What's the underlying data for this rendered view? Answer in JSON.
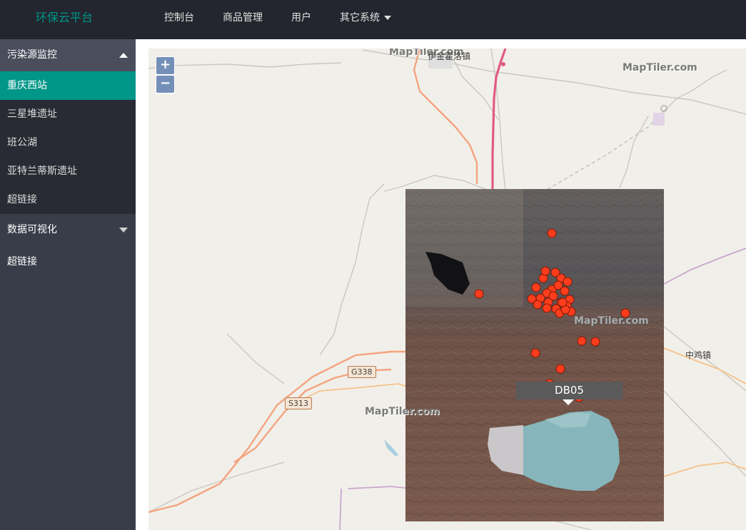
{
  "header": {
    "brand": "环保云平台",
    "nav": [
      {
        "label": "控制台"
      },
      {
        "label": "商品管理"
      },
      {
        "label": "用户"
      },
      {
        "label": "其它系统"
      }
    ]
  },
  "sidebar": {
    "group1": {
      "label": "污染源监控",
      "items": [
        {
          "label": "重庆西站"
        },
        {
          "label": "三星堆遗址"
        },
        {
          "label": "班公湖"
        },
        {
          "label": "亚特兰蒂斯遗址"
        },
        {
          "label": "超链接"
        }
      ]
    },
    "group2": {
      "label": "数据可视化"
    },
    "link": {
      "label": "超链接"
    }
  },
  "map": {
    "zoom_in": "+",
    "zoom_out": "−",
    "places": {
      "town1": "伊金霍洛镇",
      "town2": "中鸡镇"
    },
    "roads": {
      "g338": "G338",
      "s313": "S313"
    },
    "watermark": "MapTiler.com",
    "popup_label": "DB05",
    "colors": {
      "marker_fill": "#ff3d1c",
      "marker_stroke": "#7a1a08",
      "primary_road": "#e15b7e",
      "secondary_road": "#f4a27e",
      "minor_road": "#bdbdbd"
    }
  }
}
